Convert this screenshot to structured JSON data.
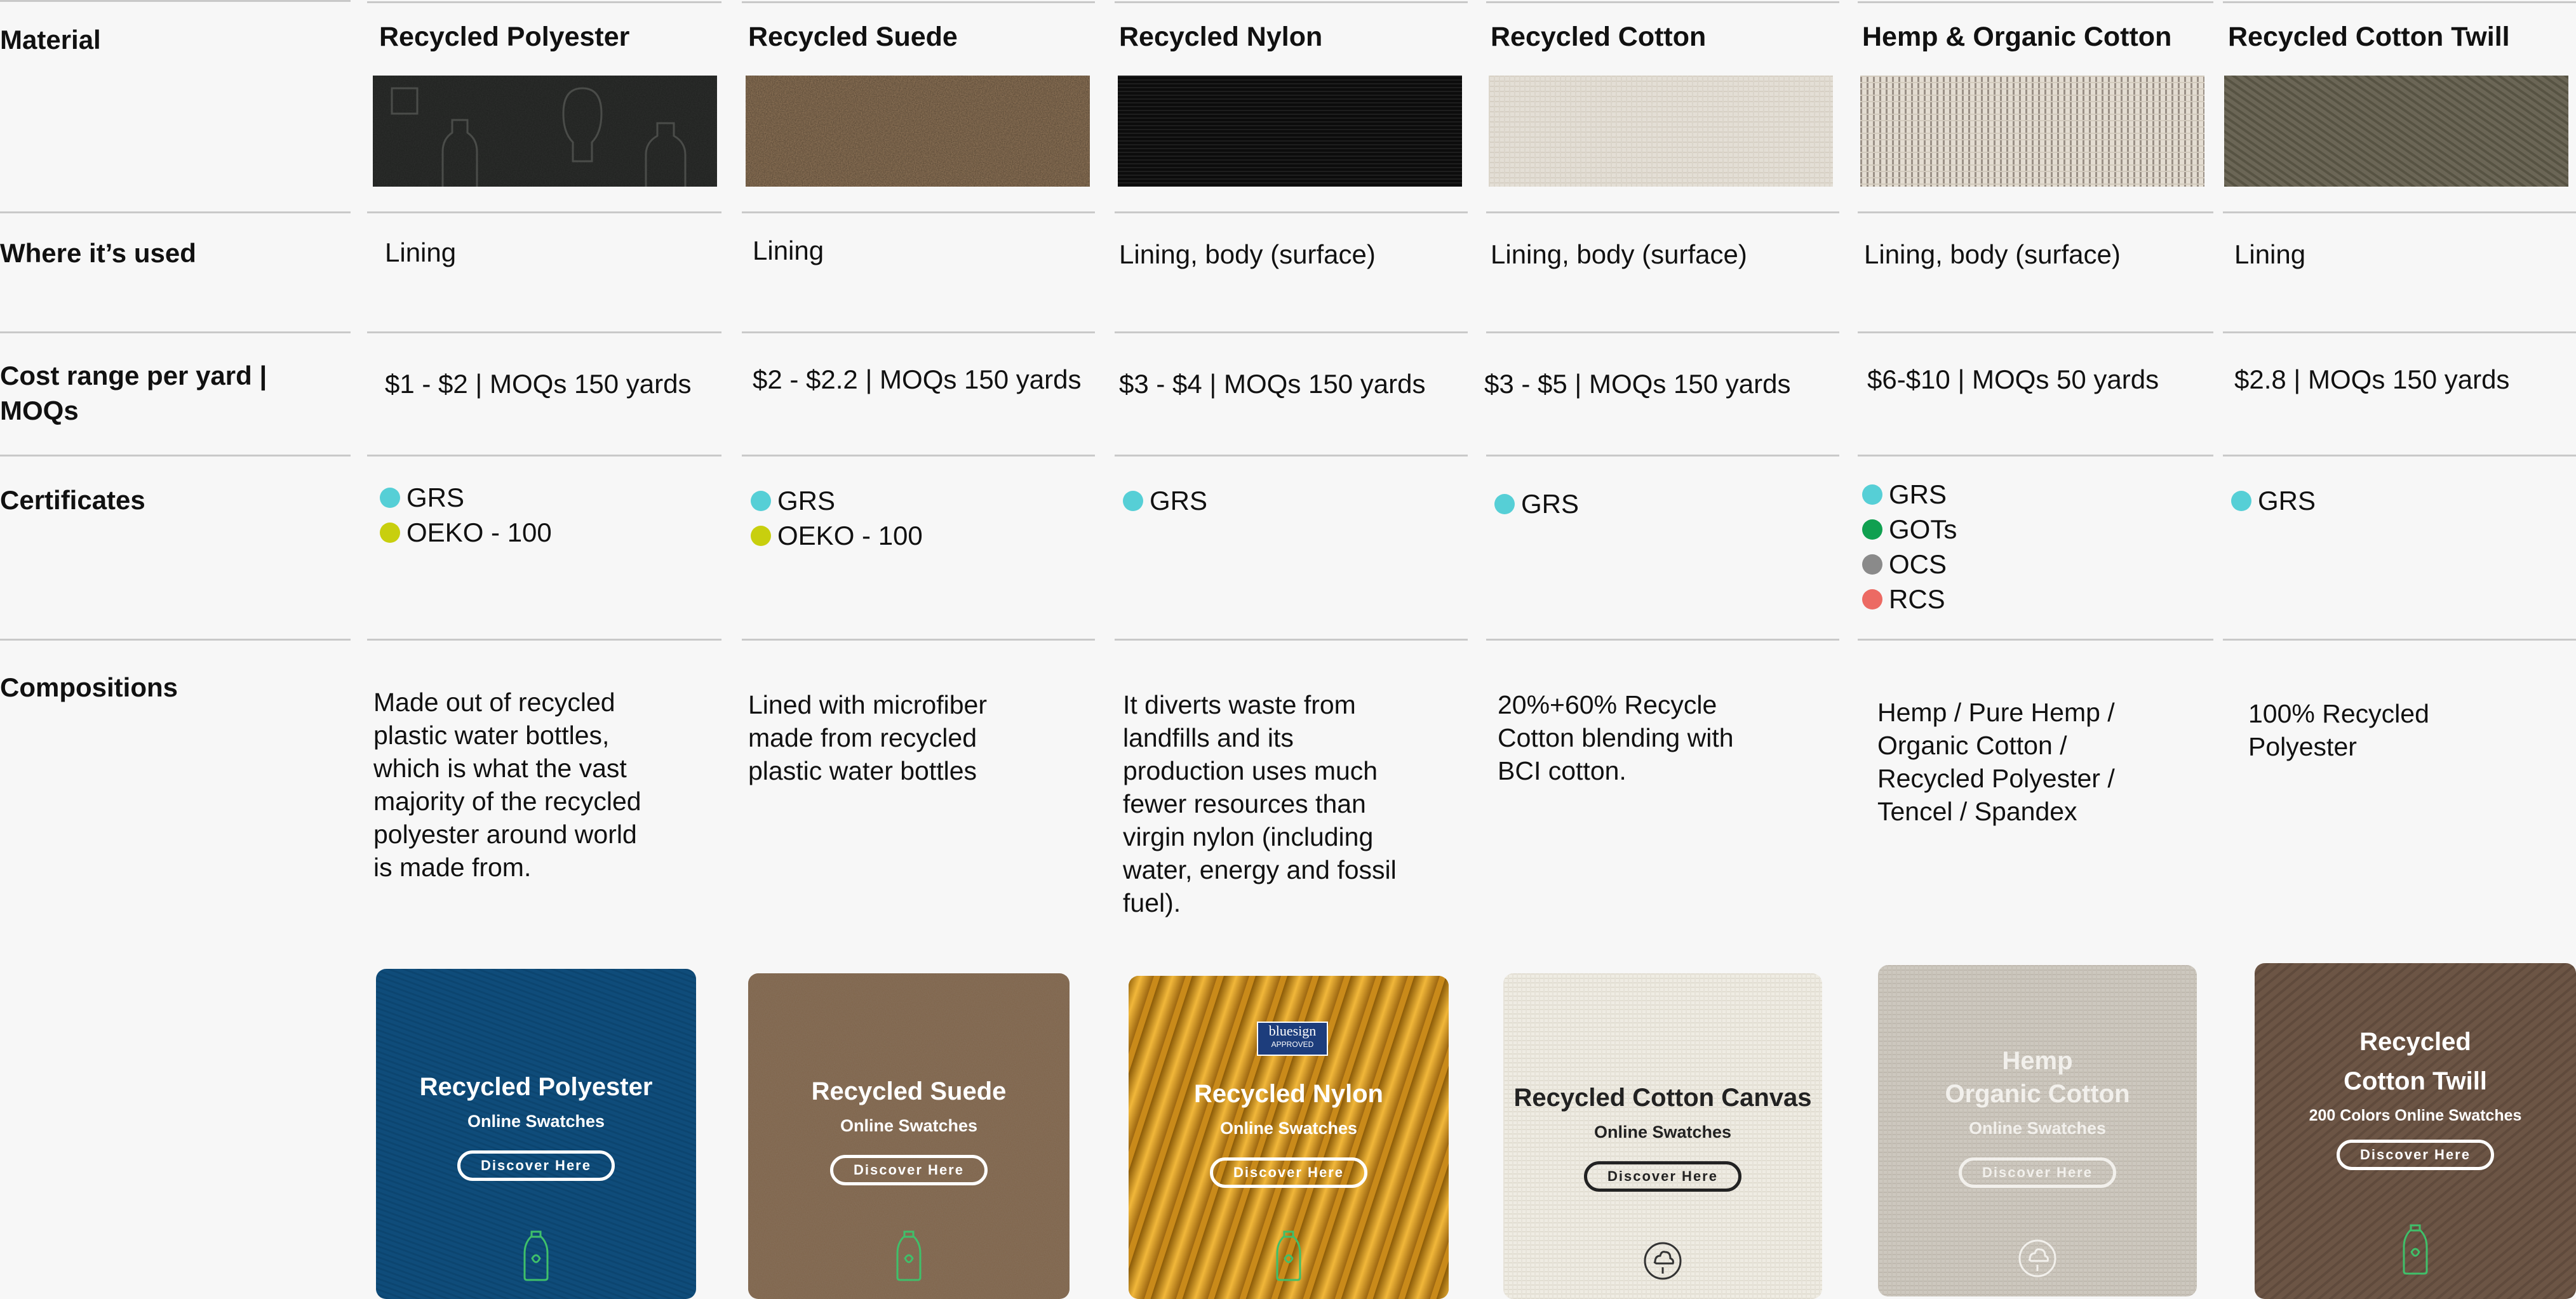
{
  "row_labels": {
    "material": "Material",
    "used": "Where it’s used",
    "cost": "Cost range per yard | MOQs",
    "certificates": "Certificates",
    "compositions": "Compositions"
  },
  "materials": [
    {
      "name": "Recycled Polyester",
      "used": "Lining",
      "cost": "$1 - $2 | MOQs 150 yards",
      "certificates": [
        {
          "label": "GRS",
          "color": "#56cfd6"
        },
        {
          "label": "OEKO - 100",
          "color": "#c8cf0e"
        }
      ],
      "composition": [
        "Made out of recycled",
        "plastic water bottles,",
        "which is what the vast",
        "majority of the recycled",
        "polyester around world",
        "is made from."
      ],
      "card": {
        "title": [
          "Recycled Polyester"
        ],
        "subtitle": "Online Swatches",
        "button": "Discover Here",
        "icon": "bottle-icon"
      }
    },
    {
      "name": "Recycled Suede",
      "used": "Lining",
      "cost": "$2 - $2.2 | MOQs 150 yards",
      "certificates": [
        {
          "label": "GRS",
          "color": "#56cfd6"
        },
        {
          "label": "OEKO - 100",
          "color": "#c8cf0e"
        }
      ],
      "composition": [
        "Lined with microfiber",
        "made from recycled",
        "plastic water bottles"
      ],
      "card": {
        "title": [
          "Recycled Suede"
        ],
        "subtitle": "Online Swatches",
        "button": "Discover Here",
        "icon": "bottle-icon"
      }
    },
    {
      "name": "Recycled Nylon",
      "used": "Lining, body (surface)",
      "cost": "$3 - $4 | MOQs 150 yards",
      "certificates": [
        {
          "label": "GRS",
          "color": "#56cfd6"
        }
      ],
      "composition": [
        "It diverts waste from",
        "landfills and its",
        "production uses much",
        "fewer resources than",
        "virgin nylon (including",
        "water, energy and fossil",
        "fuel)."
      ],
      "card": {
        "title": [
          "Recycled Nylon"
        ],
        "subtitle": "Online Swatches",
        "button": "Discover Here",
        "icon": "bottle-icon",
        "badge": [
          "bluesign",
          "APPROVED"
        ]
      }
    },
    {
      "name": "Recycled Cotton",
      "used": "Lining, body (surface)",
      "cost": "$3 - $5 | MOQs 150 yards",
      "certificates": [
        {
          "label": "GRS",
          "color": "#56cfd6"
        }
      ],
      "composition": [
        "20%+60% Recycle",
        "Cotton blending with",
        "BCI cotton."
      ],
      "card": {
        "title": [
          "Recycled Cotton Canvas"
        ],
        "subtitle": "Online Swatches",
        "button": "Discover Here",
        "icon": "cotton-icon"
      }
    },
    {
      "name": "Hemp & Organic Cotton",
      "used": "Lining, body (surface)",
      "cost": "$6-$10 | MOQs 50 yards",
      "certificates": [
        {
          "label": "GRS",
          "color": "#56cfd6"
        },
        {
          "label": "GOTs",
          "color": "#10a050"
        },
        {
          "label": "OCS",
          "color": "#8a8a8a"
        },
        {
          "label": "RCS",
          "color": "#ec6a63"
        }
      ],
      "composition": [
        "Hemp / Pure Hemp /",
        "Organic Cotton /",
        "Recycled Polyester /",
        "Tencel / Spandex"
      ],
      "card": {
        "title": [
          "Hemp",
          "Organic Cotton"
        ],
        "subtitle": "Online Swatches",
        "button": "Discover Here",
        "icon": "cotton-icon"
      }
    },
    {
      "name": "Recycled Cotton Twill",
      "used": "Lining",
      "cost": "$2.8 | MOQs 150 yards",
      "certificates": [
        {
          "label": "GRS",
          "color": "#56cfd6"
        }
      ],
      "composition": [
        "100% Recycled",
        "Polyester"
      ],
      "card": {
        "title": [
          "Recycled",
          "Cotton Twill"
        ],
        "subtitle": "200 Colors Online Swatches",
        "button": "Discover Here",
        "icon": "bottle-icon"
      }
    }
  ]
}
